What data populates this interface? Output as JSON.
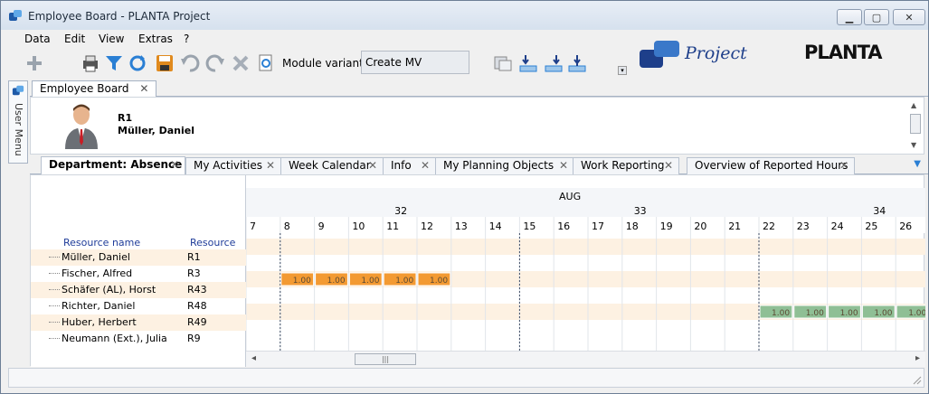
{
  "window": {
    "title": "Employee Board - PLANTA Project",
    "min": "▁",
    "max": "▢",
    "close": "✕"
  },
  "menu": {
    "data": "Data",
    "edit": "Edit",
    "view": "View",
    "extras": "Extras",
    "help": "?"
  },
  "toolbar": {
    "module_variant_label": "Module variant:",
    "module_variant_value": "Create MV",
    "logo_project": "Project",
    "logo_planta": "PLANTA"
  },
  "user_menu": {
    "label": "User Menu"
  },
  "module_tab": {
    "label": "Employee Board",
    "close": "✕"
  },
  "header": {
    "resource_id": "R1",
    "resource_name": "Müller, Daniel"
  },
  "tabs": [
    {
      "label": "Department: Absence",
      "close": "✕"
    },
    {
      "label": "My Activities",
      "close": "✕"
    },
    {
      "label": "Week Calendar",
      "close": "✕"
    },
    {
      "label": "Info",
      "close": "✕"
    },
    {
      "label": "My Planning Objects",
      "close": "✕"
    },
    {
      "label": "Work Reporting",
      "close": "✕"
    },
    {
      "label": "Overview of Reported Hours",
      "close": "✕"
    }
  ],
  "table": {
    "col_name": "Resource name",
    "col_id": "Resource",
    "rows": [
      {
        "name": "Müller, Daniel",
        "id": "R1"
      },
      {
        "name": "Fischer, Alfred",
        "id": "R3"
      },
      {
        "name": "Schäfer (AL), Horst",
        "id": "R43"
      },
      {
        "name": "Richter, Daniel",
        "id": "R48"
      },
      {
        "name": "Huber, Herbert",
        "id": "R49"
      },
      {
        "name": "Neumann (Ext.), Julia",
        "id": "R9"
      }
    ]
  },
  "timeline": {
    "month": "AUG",
    "weeks": [
      "32",
      "33",
      "34"
    ],
    "days": [
      "7",
      "8",
      "9",
      "10",
      "11",
      "12",
      "13",
      "14",
      "15",
      "16",
      "17",
      "18",
      "19",
      "20",
      "21",
      "22",
      "23",
      "24",
      "25",
      "26"
    ],
    "bars": [
      {
        "row": 2,
        "day_start": 1,
        "day_end": 5,
        "value": "1.00",
        "color": "#f39a32"
      },
      {
        "row": 4,
        "day_start": 15,
        "day_end": 19,
        "value": "1.00",
        "color": "#8fbf95"
      }
    ],
    "scroll_left": "◂",
    "scroll_right": "▸",
    "scroll_thumb": "|||"
  },
  "colors": {
    "accent_blue": "#1f3c99",
    "bar_orange": "#f39a32",
    "bar_green": "#8fbf95",
    "row_alt": "#fdf1e2"
  }
}
